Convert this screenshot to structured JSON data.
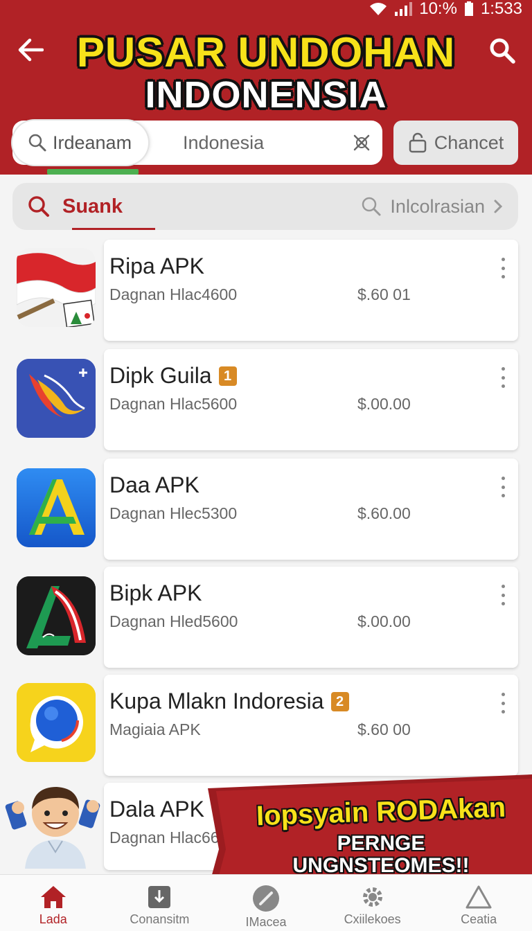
{
  "status_bar": {
    "battery_text": "10:%",
    "time": "1:533"
  },
  "header": {
    "title_line1": "PUSAR UNDOHAN",
    "title_line2": "INDONENSIA",
    "search_chip_label": "Irdeanam",
    "search_value": "Indonesia",
    "channel_button": "Chancet"
  },
  "filter": {
    "active_tab": "Suank",
    "other_tab": "Inlcolrasian"
  },
  "apps": [
    {
      "name": "Ripa APK",
      "badge": "",
      "subtitle": "Dagnan Hlac4600",
      "price": "$.60 01",
      "icon": "indonesia-flag-icon"
    },
    {
      "name": "Dipk Guila",
      "badge": "1",
      "subtitle": "Dagnan Hlac5600",
      "price": "$.00.00",
      "icon": "bird-icon"
    },
    {
      "name": "Daa APK",
      "badge": "",
      "subtitle": "Dagnan Hlec5300",
      "price": "$.60.00",
      "icon": "letter-a-icon"
    },
    {
      "name": "Bipk APK",
      "badge": "",
      "subtitle": "Dagnan Hled5600",
      "price": "$.00.00",
      "icon": "red-a-icon"
    },
    {
      "name": "Kupa Mlakn Indoresia",
      "badge": "2",
      "subtitle": "Magiaia APK",
      "price": "$.60 00",
      "icon": "chat-bubble-icon"
    },
    {
      "name": "Dala APK",
      "badge": "",
      "subtitle": "Dagnan Hlac660C",
      "price": "",
      "icon": "mascot-icon"
    }
  ],
  "promo": {
    "line1": "Iopsyain RODAkan",
    "line2": "PERNGE",
    "line3": "UNGNSTEOMES!!"
  },
  "bottom_nav": [
    {
      "label": "Lada",
      "icon": "home-icon"
    },
    {
      "label": "Conansitm",
      "icon": "download-icon"
    },
    {
      "label": "IMacea",
      "icon": "pencil-icon"
    },
    {
      "label": "Cxiilekoes",
      "icon": "gear-icon"
    },
    {
      "label": "Ceatia",
      "icon": "triangle-icon"
    }
  ],
  "colors": {
    "brand_red": "#b12226",
    "title_yellow": "#f7e21a",
    "badge_orange": "#d88a25"
  }
}
